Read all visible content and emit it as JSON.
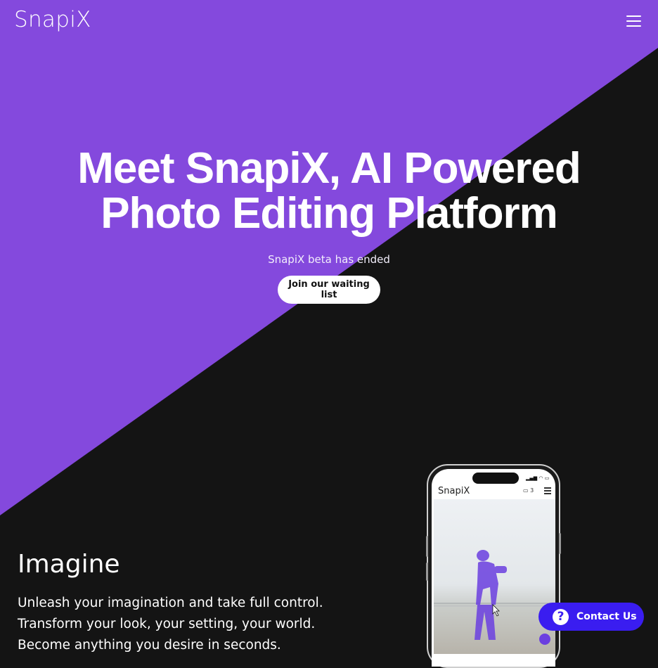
{
  "header": {
    "logo": "SnapiX",
    "menu_icon": "hamburger-menu-icon"
  },
  "hero": {
    "title_line1": "Meet SnapiX, AI Powered",
    "title_line2": "Photo Editing Platform",
    "subtitle": "SnapiX beta has ended",
    "cta_label": "Join our waiting list"
  },
  "feature": {
    "title": "Imagine",
    "lines": [
      "Unleash your imagination and take full control.",
      "Transform your look, your setting, your world.",
      "Become anything you desire in seconds."
    ]
  },
  "phone_mockup": {
    "app_name": "SnapiX",
    "count": "3"
  },
  "contact": {
    "label": "Contact Us",
    "icon": "question-circle-icon"
  },
  "colors": {
    "brand_purple": "#8449dd",
    "background_dark": "#141414",
    "contact_blue": "#3a1df0"
  }
}
